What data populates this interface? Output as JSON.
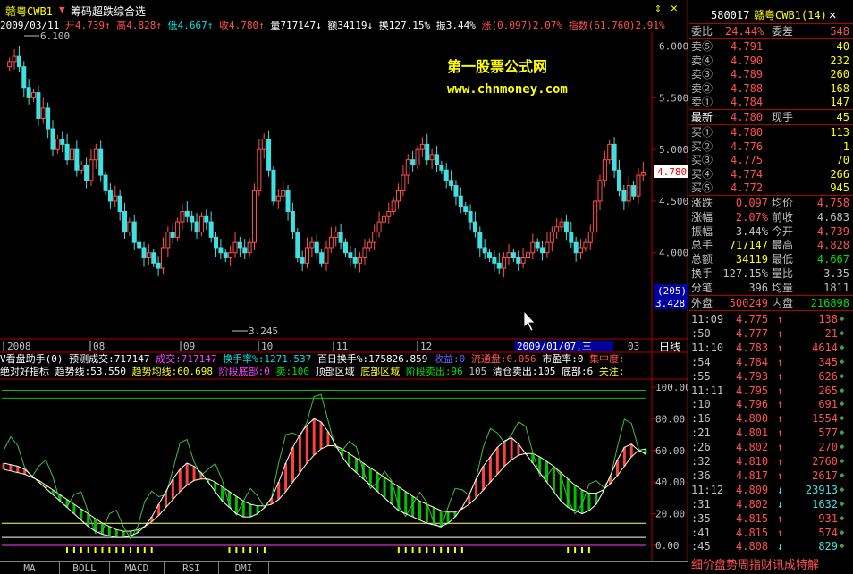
{
  "header": {
    "stock_name": "赣粤CWB1",
    "formula_name": "筹码超跌综合选",
    "date": "2009/03/11",
    "open_label": "开",
    "open": "4.739",
    "high_label": "高",
    "high": "4.828",
    "low_label": "低",
    "low": "4.667",
    "close_label": "收",
    "close": "4.780",
    "volume_label": "量",
    "volume": "717147",
    "amount_label": "额",
    "amount": "34119",
    "turnover_label": "换",
    "turnover": "127.15%",
    "amplitude_label": "振",
    "amplitude": "3.44%",
    "change_label": "涨",
    "change": "(0.097)2.07%",
    "index_label": "指数",
    "index": "(61.760)2.91%"
  },
  "main_chart": {
    "max_label": "6.100",
    "min_label": "3.245",
    "y_ticks": [
      "6.000",
      "5.500",
      "5.000",
      "4.500",
      "4.000"
    ],
    "y_values": [
      6.0,
      5.5,
      5.0,
      4.5,
      4.0
    ],
    "price_tag": "4.780",
    "bottom_tag_top": "(205)",
    "bottom_tag_bottom": "3.428",
    "watermark_title": "第一股票公式网",
    "watermark_url": "www.chnmoney.com",
    "x_labels": [
      "2008",
      "08",
      "09",
      "10",
      "11",
      "12"
    ],
    "crosshair_date": "2009/01/07,三",
    "last_x_label": "03",
    "period_label": "日线"
  },
  "indicator_info": {
    "row1": [
      {
        "t": "V看盘助手(0) 预测成交:717147",
        "c": "white"
      },
      {
        "t": "成交:717147",
        "c": "magenta"
      },
      {
        "t": "换手率%:1271.537",
        "c": "cyan"
      },
      {
        "t": "百日换手%:175826.859",
        "c": "white"
      },
      {
        "t": "收益:0",
        "c": "blue"
      },
      {
        "t": "流通盘:0.056",
        "c": "red"
      },
      {
        "t": "市盈率:0",
        "c": "white"
      },
      {
        "t": "集中度:",
        "c": "red"
      }
    ],
    "row2": [
      {
        "t": "绝对好指标 趋势线:53.550",
        "c": "white"
      },
      {
        "t": "趋势均线:60.698",
        "c": "yellow"
      },
      {
        "t": "阶段底部:0",
        "c": "magenta"
      },
      {
        "t": "卖:100",
        "c": "green"
      },
      {
        "t": "顶部区域",
        "c": "white"
      },
      {
        "t": "底部区域",
        "c": "yellow"
      },
      {
        "t": "阶段卖出:96",
        "c": "green"
      },
      {
        "t": "105",
        "c": "gray"
      },
      {
        "t": "清仓卖出:105",
        "c": "white"
      },
      {
        "t": "底部:6",
        "c": "white"
      },
      {
        "t": "关注:",
        "c": "yellow"
      }
    ]
  },
  "indicator_axis": {
    "labels": [
      "100.00",
      "80.00",
      "60.00",
      "40.00",
      "20.00",
      "0.00"
    ],
    "values": [
      100,
      80,
      60,
      40,
      20,
      0
    ]
  },
  "tabs": [
    "MA",
    "BOLL",
    "MACD",
    "RSI",
    "DMI"
  ],
  "quote": {
    "code": "580017",
    "name": "赣粤CWB1(14)",
    "weibi_label": "委比",
    "weibi": "24.44%",
    "weicha_label": "委差",
    "weicha": "548",
    "sells": [
      {
        "label": "卖⑤",
        "price": "4.791",
        "vol": "40"
      },
      {
        "label": "卖④",
        "price": "4.790",
        "vol": "232"
      },
      {
        "label": "卖③",
        "price": "4.789",
        "vol": "260"
      },
      {
        "label": "卖②",
        "price": "4.788",
        "vol": "168"
      },
      {
        "label": "卖①",
        "price": "4.784",
        "vol": "147"
      }
    ],
    "latest_label": "最新",
    "latest": "4.780",
    "xianshou_label": "现手",
    "xianshou": "45",
    "buys": [
      {
        "label": "买①",
        "price": "4.780",
        "vol": "113"
      },
      {
        "label": "买②",
        "price": "4.776",
        "vol": "1"
      },
      {
        "label": "买③",
        "price": "4.775",
        "vol": "70"
      },
      {
        "label": "买④",
        "price": "4.774",
        "vol": "266"
      },
      {
        "label": "买⑤",
        "price": "4.772",
        "vol": "945"
      }
    ],
    "stats": [
      {
        "l1": "涨跌",
        "v1": "0.097",
        "l2": "均价",
        "v2": "4.758"
      },
      {
        "l1": "涨幅",
        "v1": "2.07%",
        "l2": "前收",
        "v2": "4.683"
      },
      {
        "l1": "振幅",
        "v1": "3.44%",
        "l2": "今开",
        "v2": "4.739"
      },
      {
        "l1": "总手",
        "v1": "717147",
        "l2": "最高",
        "v2": "4.828"
      },
      {
        "l1": "总额",
        "v1": "34119",
        "l2": "最低",
        "v2": "4.667"
      },
      {
        "l1": "换手",
        "v1": "127.15%",
        "l2": "量比",
        "v2": "3.35"
      },
      {
        "l1": "分笔",
        "v1": "396",
        "l2": "均量",
        "v2": "1811"
      }
    ],
    "waipan_label": "外盘",
    "waipan": "500249",
    "neipan_label": "内盘",
    "neipan": "216898",
    "ticks": [
      {
        "time": "11:09",
        "price": "4.775",
        "dir": "↑",
        "vol": "138"
      },
      {
        "time": ":50",
        "price": "4.777",
        "dir": "↑",
        "vol": "21"
      },
      {
        "time": "11:10",
        "price": "4.783",
        "dir": "↑",
        "vol": "4614"
      },
      {
        "time": ":54",
        "price": "4.784",
        "dir": "↑",
        "vol": "345"
      },
      {
        "time": ":55",
        "price": "4.793",
        "dir": "↑",
        "vol": "626"
      },
      {
        "time": "11:11",
        "price": "4.795",
        "dir": "↑",
        "vol": "265"
      },
      {
        "time": ":10",
        "price": "4.796",
        "dir": "↑",
        "vol": "691"
      },
      {
        "time": ":16",
        "price": "4.800",
        "dir": "↑",
        "vol": "1554"
      },
      {
        "time": ":21",
        "price": "4.801",
        "dir": "↑",
        "vol": "577"
      },
      {
        "time": ":26",
        "price": "4.802",
        "dir": "↑",
        "vol": "270"
      },
      {
        "time": ":32",
        "price": "4.810",
        "dir": "↑",
        "vol": "2760"
      },
      {
        "time": ":36",
        "price": "4.817",
        "dir": "↑",
        "vol": "2617"
      },
      {
        "time": "11:12",
        "price": "4.809",
        "dir": "↓",
        "vol": "23913"
      },
      {
        "time": ":31",
        "price": "4.802",
        "dir": "↓",
        "vol": "1632"
      },
      {
        "time": ":35",
        "price": "4.815",
        "dir": "↑",
        "vol": "931"
      },
      {
        "time": ":41",
        "price": "4.815",
        "dir": "↑",
        "vol": "574"
      },
      {
        "time": ":45",
        "price": "4.808",
        "dir": "↓",
        "vol": "829"
      }
    ],
    "footer_tabs": "细价盘势周指财讯成特解"
  },
  "chart_data": {
    "type": "candlestick",
    "price_close": [
      5.85,
      5.9,
      5.8,
      5.6,
      5.5,
      5.55,
      5.3,
      5.4,
      5.2,
      5.0,
      5.1,
      5.05,
      4.9,
      5.0,
      4.8,
      4.85,
      4.7,
      4.9,
      5.0,
      4.75,
      4.6,
      4.5,
      4.55,
      4.4,
      4.2,
      4.3,
      4.1,
      4.05,
      3.95,
      4.0,
      3.9,
      3.85,
      4.05,
      4.2,
      4.15,
      4.3,
      4.4,
      4.35,
      4.3,
      4.2,
      4.35,
      4.3,
      4.15,
      4.05,
      4.0,
      3.95,
      4.0,
      4.1,
      4.05,
      4.0,
      4.1,
      4.6,
      5.0,
      5.1,
      4.8,
      4.5,
      4.55,
      4.6,
      4.4,
      4.2,
      3.95,
      3.9,
      4.05,
      4.1,
      4.0,
      3.9,
      4.05,
      4.15,
      4.2,
      4.1,
      4.0,
      3.95,
      3.9,
      3.95,
      4.05,
      4.1,
      4.2,
      4.3,
      4.35,
      4.4,
      4.5,
      4.6,
      4.75,
      4.9,
      4.85,
      5.0,
      5.05,
      4.9,
      4.95,
      4.85,
      4.8,
      4.7,
      4.65,
      4.55,
      4.45,
      4.4,
      4.3,
      4.2,
      4.05,
      4.0,
      3.95,
      3.9,
      3.85,
      3.95,
      4.0,
      3.95,
      3.9,
      3.95,
      4.0,
      4.1,
      4.05,
      4.0,
      4.1,
      4.2,
      4.25,
      4.3,
      4.2,
      4.1,
      4.0,
      4.05,
      4.1,
      4.2,
      4.5,
      4.7,
      4.9,
      5.05,
      4.8,
      4.6,
      4.5,
      4.65,
      4.55,
      4.75,
      4.78
    ],
    "indicator_trend": [
      52,
      51,
      50,
      48,
      44,
      40,
      36,
      32,
      28,
      24,
      20,
      16,
      12,
      9,
      7,
      6,
      5,
      5,
      6,
      8,
      12,
      18,
      26,
      34,
      42,
      48,
      52,
      50,
      46,
      40,
      34,
      28,
      24,
      20,
      18,
      18,
      20,
      24,
      30,
      40,
      52,
      62,
      70,
      76,
      80,
      78,
      72,
      64,
      56,
      50,
      46,
      42,
      38,
      34,
      30,
      26,
      22,
      20,
      18,
      16,
      14,
      13,
      12,
      14,
      18,
      24,
      32,
      42,
      50,
      56,
      62,
      66,
      68,
      64,
      58,
      52,
      46,
      40,
      34,
      28,
      24,
      22,
      20,
      22,
      26,
      34,
      44,
      54,
      62,
      64,
      60,
      58
    ],
    "indicator_ma": [
      48,
      47,
      46,
      45,
      43,
      41,
      38,
      35,
      32,
      29,
      26,
      23,
      20,
      17,
      14,
      12,
      10,
      9,
      9,
      10,
      12,
      15,
      19,
      24,
      29,
      34,
      38,
      41,
      42,
      42,
      40,
      37,
      34,
      31,
      28,
      26,
      25,
      25,
      26,
      29,
      34,
      40,
      46,
      52,
      57,
      61,
      63,
      63,
      61,
      58,
      55,
      52,
      49,
      46,
      43,
      40,
      37,
      34,
      31,
      28,
      26,
      24,
      22,
      21,
      21,
      23,
      26,
      30,
      35,
      40,
      45,
      50,
      54,
      57,
      58,
      58,
      56,
      53,
      50,
      46,
      42,
      38,
      35,
      33,
      33,
      35,
      39,
      44,
      50,
      56,
      60,
      61
    ]
  }
}
